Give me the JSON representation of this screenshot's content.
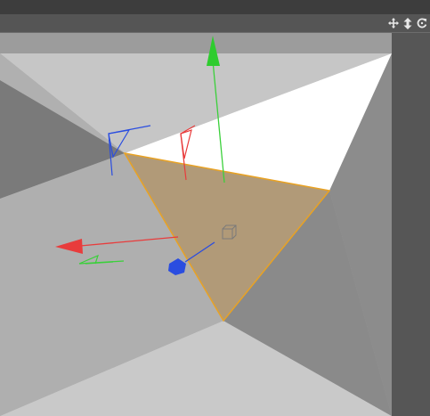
{
  "window": {
    "toolbar_icons": [
      "move-icon",
      "vertical-move-icon",
      "rotate-icon"
    ]
  },
  "viewport": {
    "selection_color": "#e8a224",
    "axis_colors": {
      "x": "#e83c3c",
      "y": "#3ad03a",
      "z": "#2a4de0"
    },
    "face_fill": "#b19a78"
  }
}
